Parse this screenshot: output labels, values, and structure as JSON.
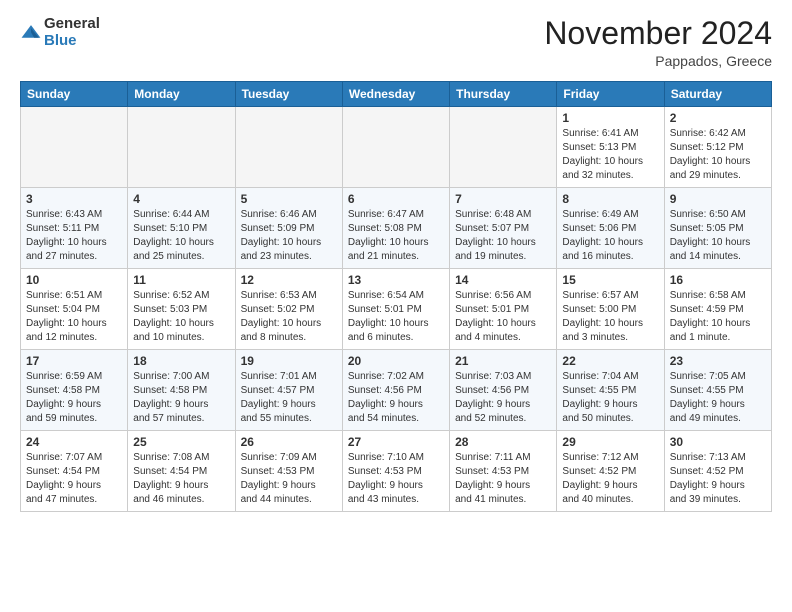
{
  "logo": {
    "general": "General",
    "blue": "Blue"
  },
  "header": {
    "month": "November 2024",
    "location": "Pappados, Greece"
  },
  "days_of_week": [
    "Sunday",
    "Monday",
    "Tuesday",
    "Wednesday",
    "Thursday",
    "Friday",
    "Saturday"
  ],
  "weeks": [
    [
      {
        "day": "",
        "info": ""
      },
      {
        "day": "",
        "info": ""
      },
      {
        "day": "",
        "info": ""
      },
      {
        "day": "",
        "info": ""
      },
      {
        "day": "",
        "info": ""
      },
      {
        "day": "1",
        "info": "Sunrise: 6:41 AM\nSunset: 5:13 PM\nDaylight: 10 hours\nand 32 minutes."
      },
      {
        "day": "2",
        "info": "Sunrise: 6:42 AM\nSunset: 5:12 PM\nDaylight: 10 hours\nand 29 minutes."
      }
    ],
    [
      {
        "day": "3",
        "info": "Sunrise: 6:43 AM\nSunset: 5:11 PM\nDaylight: 10 hours\nand 27 minutes."
      },
      {
        "day": "4",
        "info": "Sunrise: 6:44 AM\nSunset: 5:10 PM\nDaylight: 10 hours\nand 25 minutes."
      },
      {
        "day": "5",
        "info": "Sunrise: 6:46 AM\nSunset: 5:09 PM\nDaylight: 10 hours\nand 23 minutes."
      },
      {
        "day": "6",
        "info": "Sunrise: 6:47 AM\nSunset: 5:08 PM\nDaylight: 10 hours\nand 21 minutes."
      },
      {
        "day": "7",
        "info": "Sunrise: 6:48 AM\nSunset: 5:07 PM\nDaylight: 10 hours\nand 19 minutes."
      },
      {
        "day": "8",
        "info": "Sunrise: 6:49 AM\nSunset: 5:06 PM\nDaylight: 10 hours\nand 16 minutes."
      },
      {
        "day": "9",
        "info": "Sunrise: 6:50 AM\nSunset: 5:05 PM\nDaylight: 10 hours\nand 14 minutes."
      }
    ],
    [
      {
        "day": "10",
        "info": "Sunrise: 6:51 AM\nSunset: 5:04 PM\nDaylight: 10 hours\nand 12 minutes."
      },
      {
        "day": "11",
        "info": "Sunrise: 6:52 AM\nSunset: 5:03 PM\nDaylight: 10 hours\nand 10 minutes."
      },
      {
        "day": "12",
        "info": "Sunrise: 6:53 AM\nSunset: 5:02 PM\nDaylight: 10 hours\nand 8 minutes."
      },
      {
        "day": "13",
        "info": "Sunrise: 6:54 AM\nSunset: 5:01 PM\nDaylight: 10 hours\nand 6 minutes."
      },
      {
        "day": "14",
        "info": "Sunrise: 6:56 AM\nSunset: 5:01 PM\nDaylight: 10 hours\nand 4 minutes."
      },
      {
        "day": "15",
        "info": "Sunrise: 6:57 AM\nSunset: 5:00 PM\nDaylight: 10 hours\nand 3 minutes."
      },
      {
        "day": "16",
        "info": "Sunrise: 6:58 AM\nSunset: 4:59 PM\nDaylight: 10 hours\nand 1 minute."
      }
    ],
    [
      {
        "day": "17",
        "info": "Sunrise: 6:59 AM\nSunset: 4:58 PM\nDaylight: 9 hours\nand 59 minutes."
      },
      {
        "day": "18",
        "info": "Sunrise: 7:00 AM\nSunset: 4:58 PM\nDaylight: 9 hours\nand 57 minutes."
      },
      {
        "day": "19",
        "info": "Sunrise: 7:01 AM\nSunset: 4:57 PM\nDaylight: 9 hours\nand 55 minutes."
      },
      {
        "day": "20",
        "info": "Sunrise: 7:02 AM\nSunset: 4:56 PM\nDaylight: 9 hours\nand 54 minutes."
      },
      {
        "day": "21",
        "info": "Sunrise: 7:03 AM\nSunset: 4:56 PM\nDaylight: 9 hours\nand 52 minutes."
      },
      {
        "day": "22",
        "info": "Sunrise: 7:04 AM\nSunset: 4:55 PM\nDaylight: 9 hours\nand 50 minutes."
      },
      {
        "day": "23",
        "info": "Sunrise: 7:05 AM\nSunset: 4:55 PM\nDaylight: 9 hours\nand 49 minutes."
      }
    ],
    [
      {
        "day": "24",
        "info": "Sunrise: 7:07 AM\nSunset: 4:54 PM\nDaylight: 9 hours\nand 47 minutes."
      },
      {
        "day": "25",
        "info": "Sunrise: 7:08 AM\nSunset: 4:54 PM\nDaylight: 9 hours\nand 46 minutes."
      },
      {
        "day": "26",
        "info": "Sunrise: 7:09 AM\nSunset: 4:53 PM\nDaylight: 9 hours\nand 44 minutes."
      },
      {
        "day": "27",
        "info": "Sunrise: 7:10 AM\nSunset: 4:53 PM\nDaylight: 9 hours\nand 43 minutes."
      },
      {
        "day": "28",
        "info": "Sunrise: 7:11 AM\nSunset: 4:53 PM\nDaylight: 9 hours\nand 41 minutes."
      },
      {
        "day": "29",
        "info": "Sunrise: 7:12 AM\nSunset: 4:52 PM\nDaylight: 9 hours\nand 40 minutes."
      },
      {
        "day": "30",
        "info": "Sunrise: 7:13 AM\nSunset: 4:52 PM\nDaylight: 9 hours\nand 39 minutes."
      }
    ]
  ]
}
